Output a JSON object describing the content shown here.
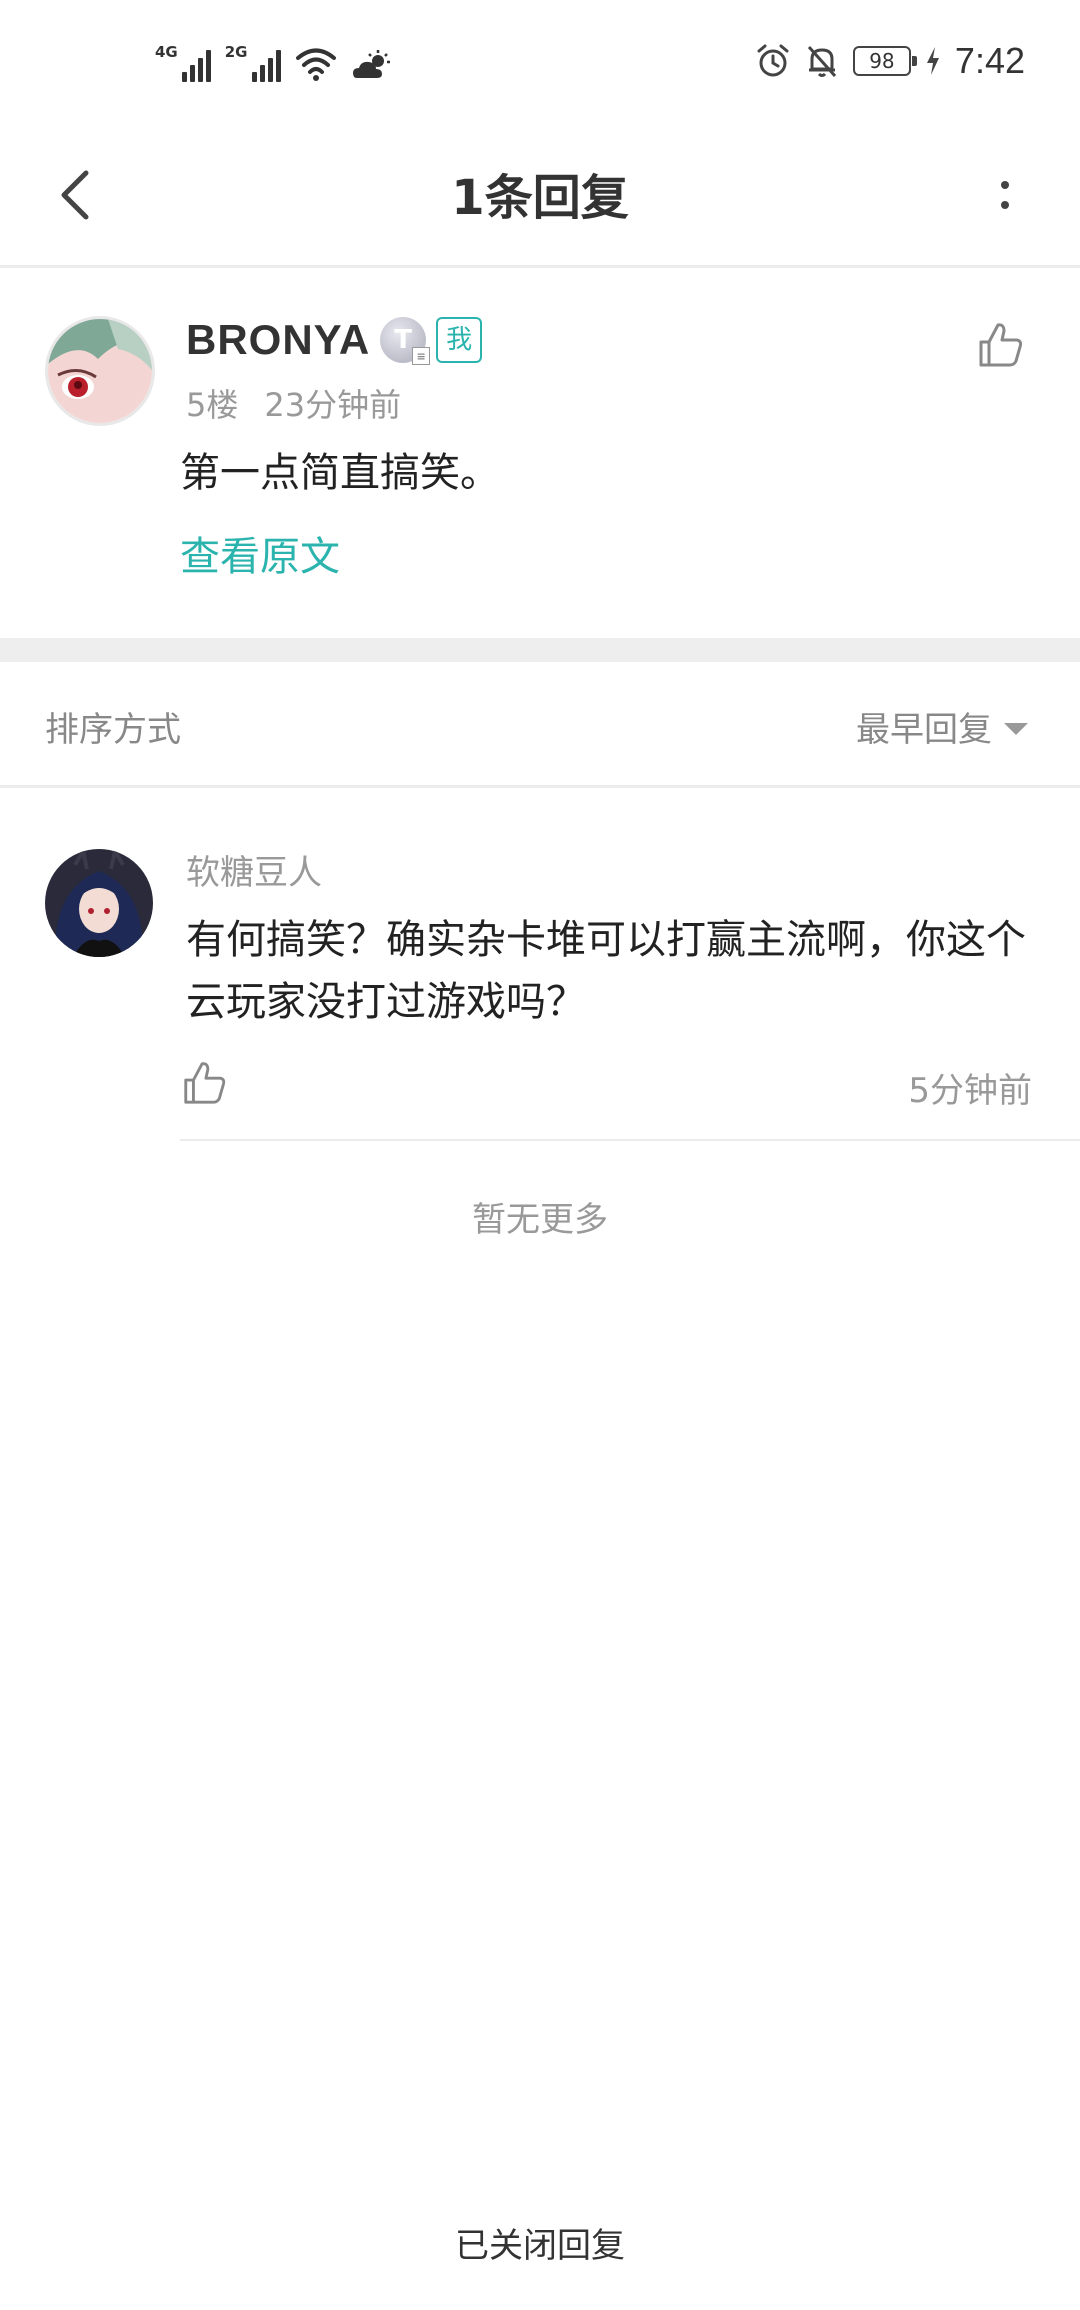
{
  "status_bar": {
    "net1": "4G",
    "net2": "2G",
    "battery": "98",
    "time": "7:42"
  },
  "header": {
    "title": "1条回复"
  },
  "original_comment": {
    "author": "BRONYA",
    "level_badge": "T",
    "me_tag": "我",
    "floor": "5楼",
    "time_ago": "23分钟前",
    "text": "第一点简直搞笑。",
    "view_original": "查看原文"
  },
  "sort": {
    "label": "排序方式",
    "selected": "最早回复"
  },
  "replies": [
    {
      "author": "软糖豆人",
      "text": "有何搞笑？确实杂卡堆可以打赢主流啊，你这个云玩家没打过游戏吗？",
      "time_ago": "5分钟前"
    }
  ],
  "no_more": "暂无更多",
  "footer": "已关闭回复",
  "colors": {
    "accent": "#2bb3ad",
    "muted": "#999999"
  }
}
